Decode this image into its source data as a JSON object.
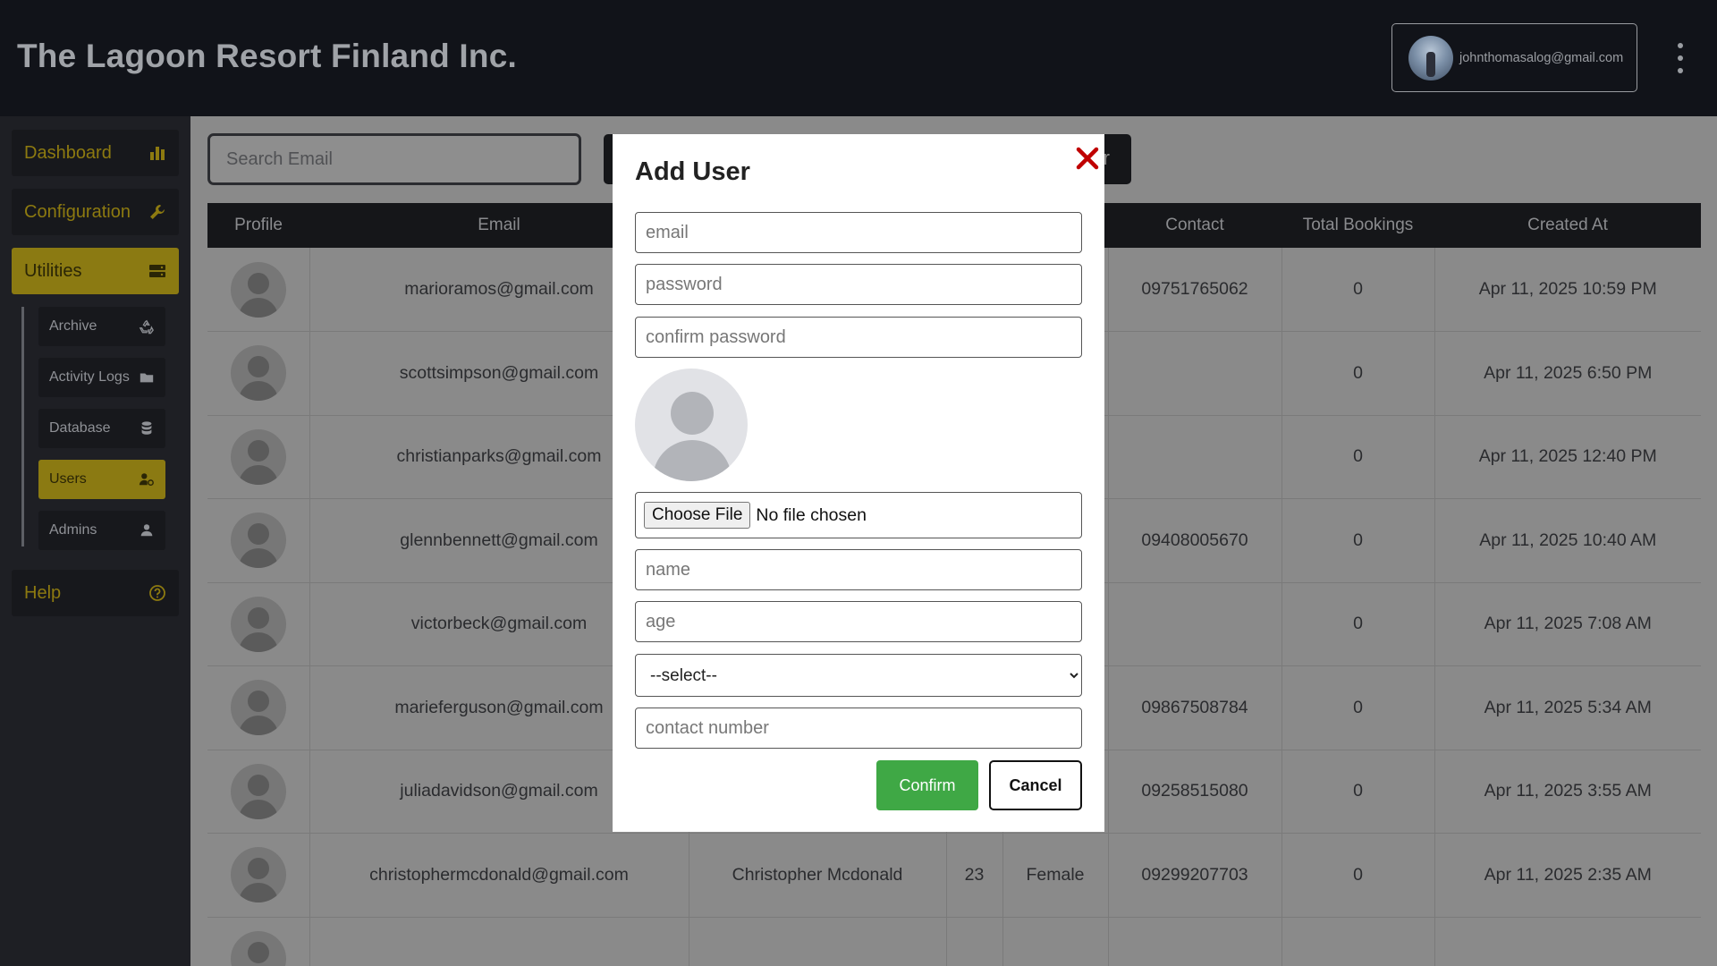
{
  "header": {
    "brand": "The Lagoon Resort Finland Inc.",
    "account_email": "johnthomasalog@gmail.com"
  },
  "sidebar": {
    "items": [
      {
        "label": "Dashboard",
        "icon": "bar-chart-icon"
      },
      {
        "label": "Configuration",
        "icon": "wrench-icon"
      },
      {
        "label": "Utilities",
        "icon": "server-icon"
      }
    ],
    "sub_items": [
      {
        "label": "Archive",
        "icon": "recycle-icon"
      },
      {
        "label": "Activity Logs",
        "icon": "folder-icon"
      },
      {
        "label": "Database",
        "icon": "database-icon"
      },
      {
        "label": "Users",
        "icon": "user-gear-icon"
      },
      {
        "label": "Admins",
        "icon": "user-icon"
      }
    ],
    "help": {
      "label": "Help",
      "icon": "question-circle-icon"
    }
  },
  "main": {
    "search_placeholder": "Search Email",
    "button_partial": "r",
    "table": {
      "headers": [
        "Profile",
        "Email",
        "",
        "",
        "",
        "Contact",
        "Total Bookings",
        "Created At"
      ],
      "rows": [
        [
          "",
          "marioramos@gmail.com",
          "",
          "",
          "",
          "09751765062",
          "0",
          "Apr 11, 2025 10:59 PM"
        ],
        [
          "",
          "scottsimpson@gmail.com",
          "",
          "",
          "",
          "",
          "0",
          "Apr 11, 2025 6:50 PM"
        ],
        [
          "",
          "christianparks@gmail.com",
          "",
          "",
          "",
          "",
          "0",
          "Apr 11, 2025 12:40 PM"
        ],
        [
          "",
          "glennbennett@gmail.com",
          "",
          "",
          "",
          "09408005670",
          "0",
          "Apr 11, 2025 10:40 AM"
        ],
        [
          "",
          "victorbeck@gmail.com",
          "",
          "",
          "",
          "",
          "0",
          "Apr 11, 2025 7:08 AM"
        ],
        [
          "",
          "marieferguson@gmail.com",
          "",
          "",
          "",
          "09867508784",
          "0",
          "Apr 11, 2025 5:34 AM"
        ],
        [
          "",
          "juliadavidson@gmail.com",
          "",
          "",
          "",
          "09258515080",
          "0",
          "Apr 11, 2025 3:55 AM"
        ],
        [
          "",
          "christophermcdonald@gmail.com",
          "Christopher Mcdonald",
          "23",
          "Female",
          "09299207703",
          "0",
          "Apr 11, 2025 2:35 AM"
        ],
        [
          "",
          "",
          "",
          "",
          "",
          "",
          "",
          ""
        ]
      ]
    }
  },
  "modal": {
    "title": "Add User",
    "email_placeholder": "email",
    "password_placeholder": "password",
    "confirm_password_placeholder": "confirm password",
    "choose_file_label": "Choose File",
    "no_file_text": "No file chosen",
    "name_placeholder": "name",
    "age_placeholder": "age",
    "gender_selected": "--select--",
    "contact_placeholder": "contact number",
    "confirm_label": "Confirm",
    "cancel_label": "Cancel"
  },
  "colors": {
    "accent": "#8b7a12",
    "confirm": "#3fa845",
    "close": "#c00000"
  }
}
